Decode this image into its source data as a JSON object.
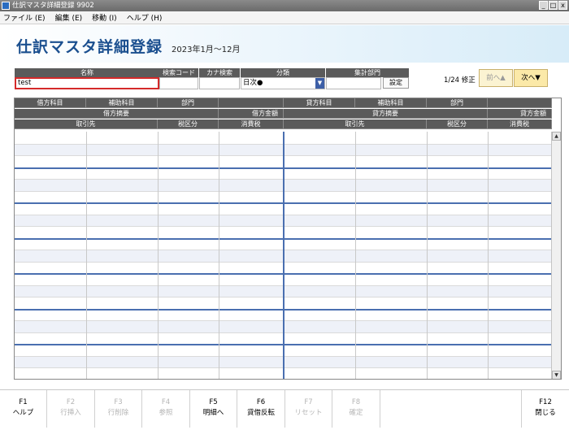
{
  "window": {
    "title": "仕訳マスタ詳細登録 9902",
    "buttons": [
      "_",
      "□",
      "x"
    ]
  },
  "menu": [
    {
      "label": "ファイル (E)"
    },
    {
      "label": "編集 (E)"
    },
    {
      "label": "移動 (I)"
    },
    {
      "label": "ヘルプ (H)"
    }
  ],
  "header": {
    "title": "仕訳マスタ詳細登録",
    "period": "2023年1月～12月"
  },
  "search": {
    "name_label": "名称",
    "name_value": "test",
    "code_label": "検索コード",
    "code_value": "",
    "kana_label": "カナ検索",
    "kana_value": "",
    "category_label": "分類",
    "category_value": "日次●",
    "dept_label": "集計部門",
    "dept_value": "",
    "settei_label": "設定"
  },
  "nav": {
    "page_info": "1/24 修正",
    "prev_label": "前へ▲",
    "next_label": "次へ▼"
  },
  "grid_headers": {
    "row1": [
      "借方科目",
      "補助科目",
      "部門",
      "",
      "貸方科目",
      "補助科目",
      "部門",
      ""
    ],
    "row2": [
      "借方摘要",
      "借方金額",
      "貸方摘要",
      "貸方金額"
    ],
    "row3": [
      "取引先",
      "税区分",
      "消費税",
      "取引先",
      "税区分",
      "消費税"
    ]
  },
  "scroll": {
    "up_icon": "▲",
    "down_icon": "▼"
  },
  "fkeys": [
    {
      "key": "F1",
      "label": "ヘルプ",
      "enabled": true
    },
    {
      "key": "F2",
      "label": "行挿入",
      "enabled": false
    },
    {
      "key": "F3",
      "label": "行削除",
      "enabled": false
    },
    {
      "key": "F4",
      "label": "参照",
      "enabled": false
    },
    {
      "key": "F5",
      "label": "明細へ",
      "enabled": true
    },
    {
      "key": "F6",
      "label": "貸借反転",
      "enabled": true
    },
    {
      "key": "F7",
      "label": "リセット",
      "enabled": false
    },
    {
      "key": "F8",
      "label": "確定",
      "enabled": false
    },
    {
      "key": "F12",
      "label": "閉じる",
      "enabled": true
    }
  ]
}
